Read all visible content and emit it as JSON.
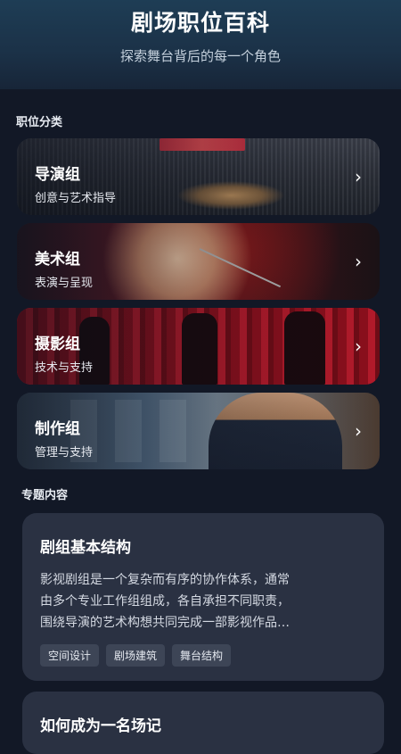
{
  "header": {
    "title": "剧场职位百科",
    "subtitle": "探索舞台背后的每一个角色"
  },
  "categories_section": {
    "label": "职位分类",
    "items": [
      {
        "name": "导演组",
        "desc": "创意与艺术指导"
      },
      {
        "name": "美术组",
        "desc": "表演与呈现"
      },
      {
        "name": "摄影组",
        "desc": "技术与支持"
      },
      {
        "name": "制作组",
        "desc": "管理与支持"
      }
    ]
  },
  "topics_section": {
    "label": "专题内容",
    "items": [
      {
        "title": "剧组基本结构",
        "body_lines": [
          "影视剧组是一个复杂而有序的协作体系，通常",
          "由多个专业工作组组成，各自承担不同职责，",
          "围绕导演的艺术构想共同完成一部影视作品…"
        ],
        "tags": [
          "空间设计",
          "剧场建筑",
          "舞台结构"
        ]
      },
      {
        "title": "如何成为一名场记"
      }
    ]
  }
}
